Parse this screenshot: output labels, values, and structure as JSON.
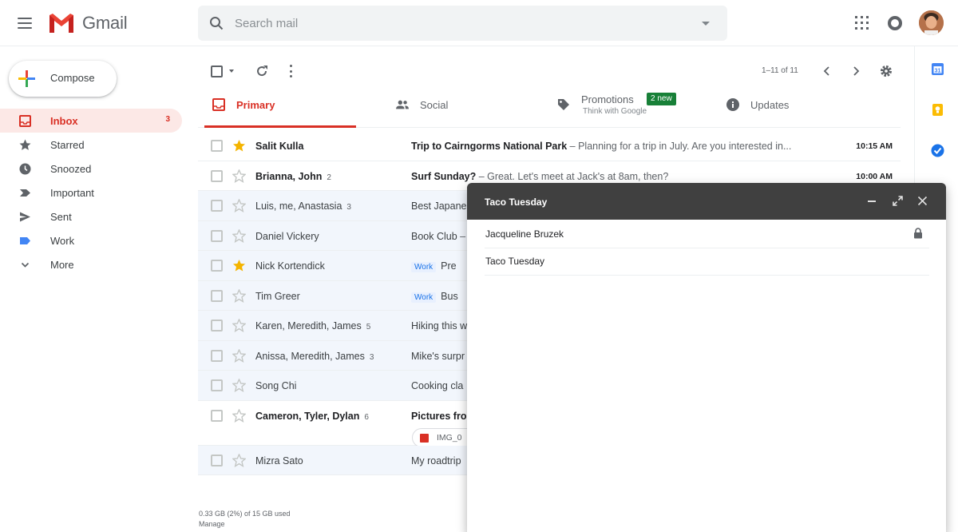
{
  "app": {
    "name": "Gmail"
  },
  "search": {
    "placeholder": "Search mail"
  },
  "compose": {
    "label": "Compose"
  },
  "nav": [
    {
      "label": "Inbox",
      "count": "3",
      "icon": "inbox-icon",
      "active": true
    },
    {
      "label": "Starred",
      "icon": "star-icon"
    },
    {
      "label": "Snoozed",
      "icon": "clock-icon"
    },
    {
      "label": "Important",
      "icon": "important-icon"
    },
    {
      "label": "Sent",
      "icon": "send-icon"
    },
    {
      "label": "Work",
      "icon": "label-icon"
    },
    {
      "label": "More",
      "icon": "chevron-down-icon"
    }
  ],
  "toolbar": {
    "range": "1–11 of 11"
  },
  "tabs": {
    "primary": {
      "label": "Primary"
    },
    "social": {
      "label": "Social"
    },
    "promotions": {
      "label": "Promotions",
      "badge": "2 new",
      "sub": "Think with Google"
    },
    "updates": {
      "label": "Updates"
    }
  },
  "messages": [
    {
      "sender": "Salit Kulla",
      "count": "",
      "subject": "Trip to Cairngorms National Park",
      "snippet": " – Planning for a trip in July. Are you interested in...",
      "label": "",
      "time": "10:15 AM",
      "starred": true,
      "unread": true
    },
    {
      "sender": "Brianna, John",
      "count": "2",
      "subject": "Surf Sunday?",
      "snippet": " – Great. Let's meet at Jack's at 8am, then?",
      "label": "",
      "time": "10:00 AM",
      "starred": false,
      "unread": true
    },
    {
      "sender": "Luis, me, Anastasia",
      "count": "3",
      "subject": "Best Japanese",
      "snippet": "",
      "label": "",
      "time": "",
      "starred": false,
      "unread": false
    },
    {
      "sender": "Daniel Vickery",
      "count": "",
      "subject": "Book Club",
      "snippet": " –",
      "label": "",
      "time": "",
      "starred": false,
      "unread": false
    },
    {
      "sender": "Nick Kortendick",
      "count": "",
      "subject": "Pre",
      "snippet": "",
      "label": "Work",
      "time": "",
      "starred": true,
      "unread": false
    },
    {
      "sender": "Tim Greer",
      "count": "",
      "subject": "Bus",
      "snippet": "",
      "label": "Work",
      "time": "",
      "starred": false,
      "unread": false
    },
    {
      "sender": "Karen, Meredith, James",
      "count": "5",
      "subject": "Hiking this w",
      "snippet": "",
      "label": "",
      "time": "",
      "starred": false,
      "unread": false
    },
    {
      "sender": "Anissa, Meredith, James",
      "count": "3",
      "subject": "Mike's surpr",
      "snippet": "",
      "label": "",
      "time": "",
      "starred": false,
      "unread": false
    },
    {
      "sender": "Song Chi",
      "count": "",
      "subject": "Cooking cla",
      "snippet": "",
      "label": "",
      "time": "",
      "starred": false,
      "unread": false
    },
    {
      "sender": "Cameron, Tyler, Dylan",
      "count": "6",
      "subject": "Pictures fro",
      "snippet": "",
      "label": "",
      "time": "",
      "starred": false,
      "unread": true,
      "attachment": "IMG_0"
    },
    {
      "sender": "Mizra Sato",
      "count": "",
      "subject": "My roadtrip",
      "snippet": "",
      "label": "",
      "time": "",
      "starred": false,
      "unread": false
    }
  ],
  "storage": {
    "usage": "0.33 GB (2%) of 15 GB used",
    "manage": "Manage"
  },
  "compose_window": {
    "title": "Taco Tuesday",
    "to": "Jacqueline Bruzek",
    "subject": "Taco Tuesday"
  },
  "colors": {
    "accent": "#d93025",
    "star": "#f4b400",
    "badge": "#188038",
    "compose_header": "#404040"
  }
}
